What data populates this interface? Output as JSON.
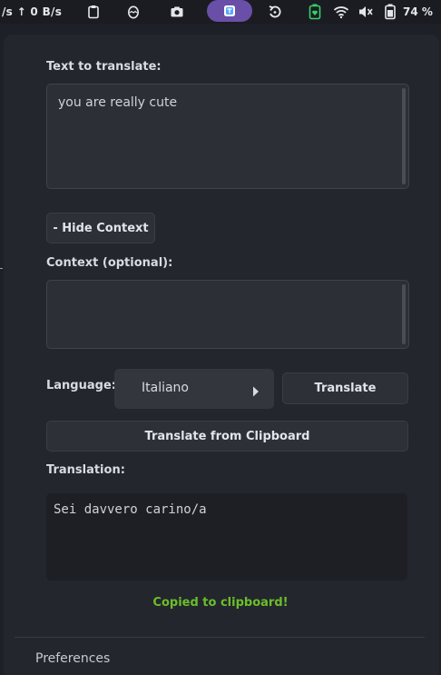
{
  "topbar": {
    "netspeed": "/s ↑ 0 B/s",
    "battery_percent": "74 %",
    "icons": [
      "clipboard-icon",
      "egg-icon",
      "camera-icon",
      "translate-app-icon",
      "refresh-icon",
      "battery-heart-icon",
      "wifi-icon",
      "volume-muted-icon",
      "battery-icon"
    ]
  },
  "translator": {
    "text_label": "Text to translate:",
    "text_value": "you are really cute",
    "hide_context_button": "- Hide Context",
    "context_label": "Context (optional):",
    "context_value": "",
    "language_label": "Language:",
    "language_selected": "Italiano",
    "translate_button": "Translate",
    "clipboard_button": "Translate from Clipboard",
    "translation_label": "Translation:",
    "translation_value": "Sei davvero carino/a",
    "status_message": "Copied to clipboard!",
    "status_color": "#6abf2a"
  },
  "footer": {
    "preferences_label": "Preferences"
  }
}
